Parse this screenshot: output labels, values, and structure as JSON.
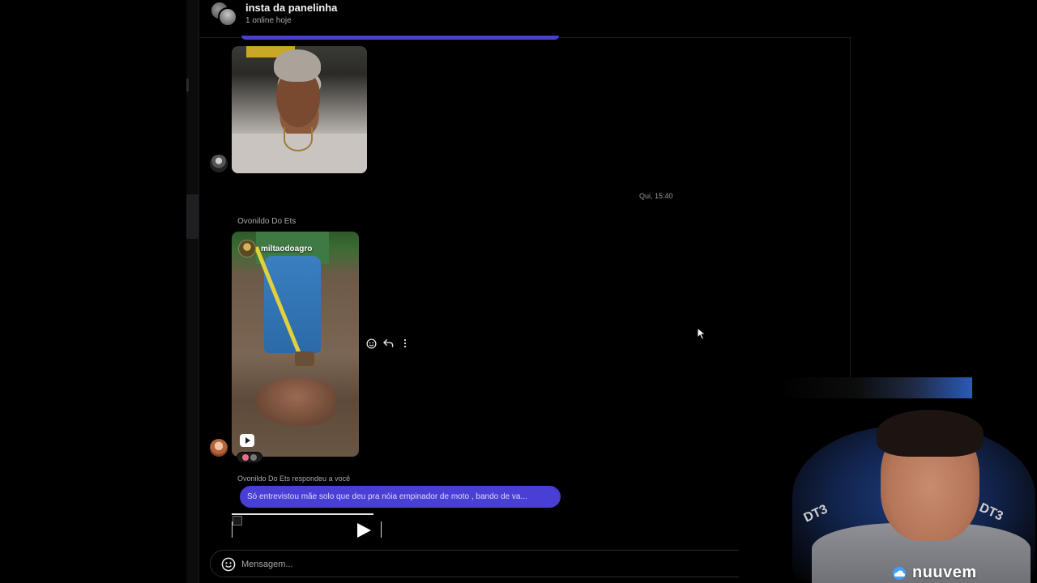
{
  "header": {
    "title": "insta da panelinha",
    "status": "1 online hoje"
  },
  "messages": {
    "timestamp": "Qui, 15:40",
    "sender_name": "Ovonildo Do Ets",
    "reel_username": "miltaodoagro",
    "replied_label": "Ovonildo Do Ets respondeu a você",
    "reply_text": "Só entrevistou mãe solo que deu pra nóia empinador de moto , bando de va..."
  },
  "composer": {
    "placeholder": "Mensagem..."
  },
  "webcam": {
    "brand": "nuuvem",
    "chair_text": "DT3"
  },
  "icons": {
    "emoji": "smiley-icon",
    "reply": "reply-arrow-icon",
    "more": "more-vertical-icon",
    "play": "play-icon",
    "reel": "reel-icon"
  },
  "colors": {
    "accent": "#4a3fd4",
    "background": "#000000",
    "text": "#f5f5f5",
    "muted": "#a8a8a8"
  }
}
